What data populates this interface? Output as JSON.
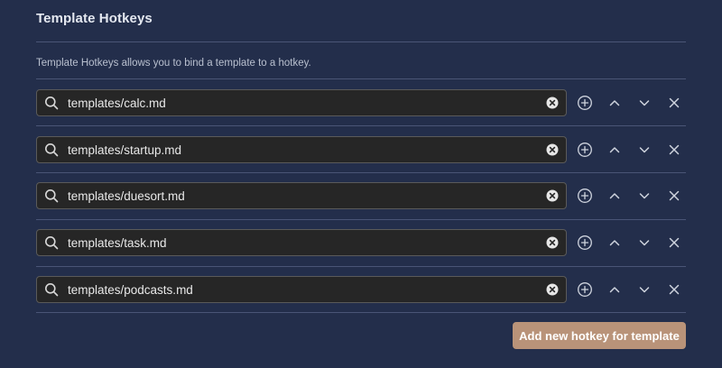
{
  "section": {
    "title": "Template Hotkeys",
    "description": "Template Hotkeys allows you to bind a template to a hotkey."
  },
  "hotkeys": [
    {
      "value": "templates/calc.md"
    },
    {
      "value": "templates/startup.md"
    },
    {
      "value": "templates/duesort.md"
    },
    {
      "value": "templates/task.md"
    },
    {
      "value": "templates/podcasts.md"
    }
  ],
  "add_button": {
    "label": "Add new hotkey for template"
  },
  "icons": {
    "search": "search-icon",
    "clear": "clear-icon",
    "add": "plus-circle-icon",
    "up": "chevron-up-icon",
    "down": "chevron-down-icon",
    "remove": "close-icon"
  },
  "colors": {
    "background": "#232e4b",
    "input_background": "#262626",
    "accent_button": "#b99379"
  }
}
